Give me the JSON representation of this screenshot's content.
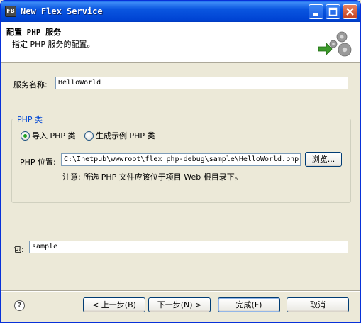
{
  "window": {
    "app_icon_text": "FB",
    "title": "New Flex Service"
  },
  "banner": {
    "title": "配置 PHP 服务",
    "description": "指定 PHP 服务的配置。",
    "icon": "gears-icon"
  },
  "service_name": {
    "label": "服务名称:",
    "value": "HelloWorld"
  },
  "php_class_group": {
    "legend": "PHP 类",
    "options": [
      {
        "label": "导入 PHP 类",
        "selected": true
      },
      {
        "label": "生成示例 PHP 类",
        "selected": false
      }
    ],
    "location_label": "PHP 位置:",
    "location_value": "C:\\Inetpub\\wwwroot\\flex_php-debug\\sample\\HelloWorld.php",
    "browse_label": "浏览...",
    "note": "注意: 所选 PHP 文件应该位于项目 Web 根目录下。"
  },
  "package": {
    "label": "包:",
    "value": "sample"
  },
  "footer": {
    "help_glyph": "?",
    "back_label": "< 上一步(B)",
    "next_label": "下一步(N) >",
    "finish_label": "完成(F)",
    "cancel_label": "取消"
  },
  "colors": {
    "titlebar": "#0a56e0",
    "group_legend": "#0046d5",
    "radio_checked": "#21a121"
  }
}
